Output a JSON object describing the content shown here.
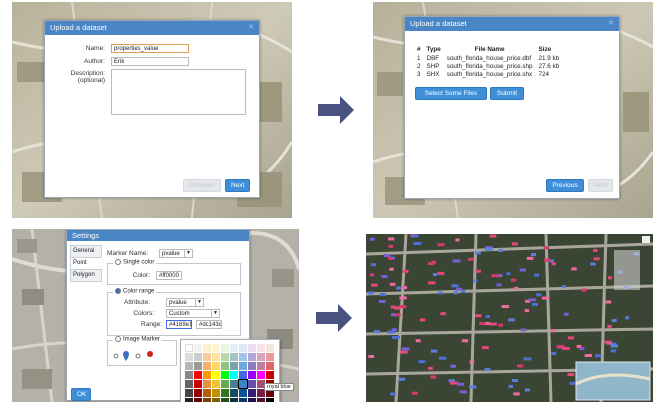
{
  "upload_dialog_1": {
    "title": "Upload a dataset",
    "name_label": "Name:",
    "name_value": "properties_value",
    "author_label": "Author:",
    "author_value": "Erik",
    "description_label": "Description:",
    "description_hint": "(optional)",
    "previous_label": "Previous",
    "next_label": "Next"
  },
  "upload_dialog_2": {
    "title": "Upload a dataset",
    "table": {
      "columns": [
        "#",
        "Type",
        "File Name",
        "Size"
      ],
      "rows": [
        [
          "1",
          "DBF",
          "south_florida_house_price.dbf",
          "21.9 kb"
        ],
        [
          "2",
          "SHP",
          "south_florida_house_price.shp",
          "27.6 kb"
        ],
        [
          "3",
          "SHX",
          "south_florida_house_price.shx",
          "724"
        ]
      ]
    },
    "select_files_label": "Select Some Files",
    "submit_label": "Submit",
    "previous_label": "Previous",
    "next_label": "Next"
  },
  "settings_dialog": {
    "title": "Settings",
    "tabs": [
      "General",
      "Point",
      "Polygon"
    ],
    "marker_name_label": "Marker Name:",
    "marker_name_value": "pvalue",
    "single_color_label": "Single color",
    "color_label": "Color:",
    "single_color_value": "#ff0000",
    "color_range_label": "Color range",
    "attribute_label": "Attribute:",
    "attribute_value": "pvalue",
    "range_color_label": "Colors:",
    "range_color_value": "Custom",
    "range_label": "Range:",
    "range_from": "#4169e1",
    "range_to": "#dc143c",
    "image_marker_label": "Image Marker",
    "ok_label": "OK",
    "tooltip": "royal blue"
  },
  "colors": {
    "accent": "#3f8fd8",
    "title_bar": "#4a86c6"
  }
}
